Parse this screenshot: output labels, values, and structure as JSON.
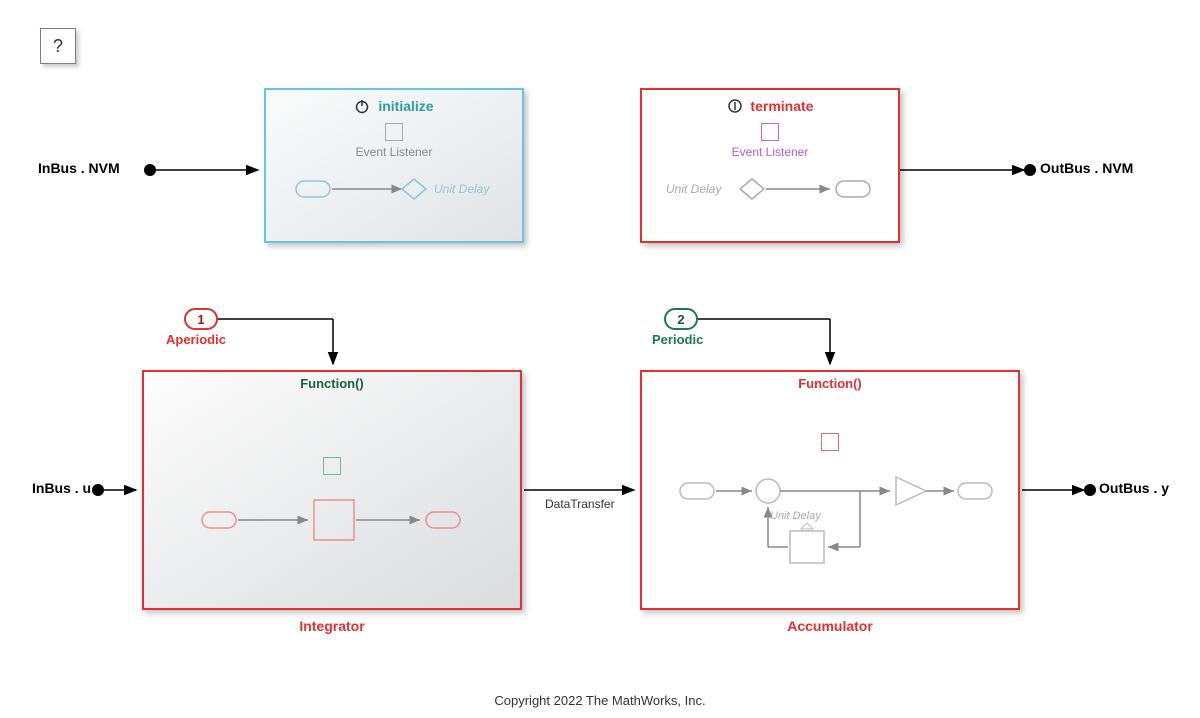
{
  "help": "?",
  "ports": {
    "in_nvm": "InBus . NVM",
    "out_nvm": "OutBus . NVM",
    "in_u": "InBus . u",
    "out_y": "OutBus . y"
  },
  "init_block": {
    "title": "initialize",
    "subtitle": "Event Listener",
    "unit_delay": "Unit Delay"
  },
  "term_block": {
    "title": "terminate",
    "subtitle": "Event Listener",
    "unit_delay": "Unit Delay"
  },
  "triggers": {
    "aperiodic": {
      "num": "1",
      "label": "Aperiodic"
    },
    "periodic": {
      "num": "2",
      "label": "Periodic"
    }
  },
  "integrator": {
    "fn_label": "Function()",
    "name": "Integrator"
  },
  "accumulator": {
    "fn_label": "Function()",
    "name": "Accumulator",
    "unit_delay": "Unit Delay"
  },
  "data_transfer": "DataTransfer",
  "copyright": "Copyright 2022 The MathWorks, Inc."
}
